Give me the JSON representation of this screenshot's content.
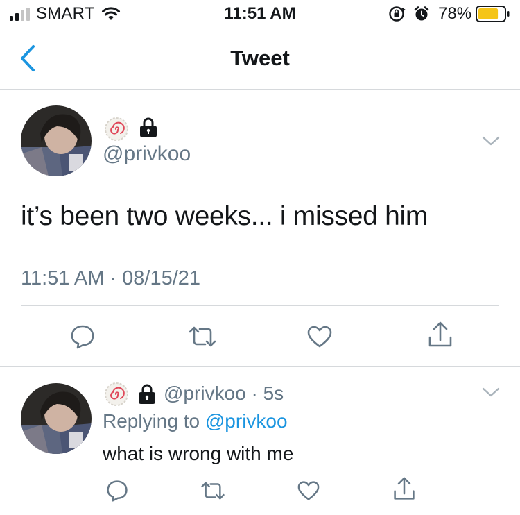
{
  "status_bar": {
    "carrier": "SMART",
    "time": "11:51 AM",
    "battery_percent": "78%",
    "battery_level": 0.78
  },
  "nav": {
    "title": "Tweet"
  },
  "main_tweet": {
    "handle": "@privkoo",
    "text": "it’s been two weeks... i missed him",
    "timestamp": "11:51 AM · 08/15/21"
  },
  "reply_tweet": {
    "handle_time": "@privkoo · 5s",
    "replying_prefix": "Replying to ",
    "replying_handle": "@privkoo",
    "text": "what is wrong with me"
  },
  "icons": {
    "back": "chevron-left-icon",
    "more": "chevron-down-icon",
    "reply": "comment-icon",
    "retweet": "retweet-icon",
    "like": "heart-icon",
    "share": "share-icon",
    "lock": "lock-icon",
    "emoji": "narutomaki-icon"
  },
  "colors": {
    "accent": "#1b95e0",
    "secondary_text": "#657786",
    "battery": "#f5c518"
  }
}
